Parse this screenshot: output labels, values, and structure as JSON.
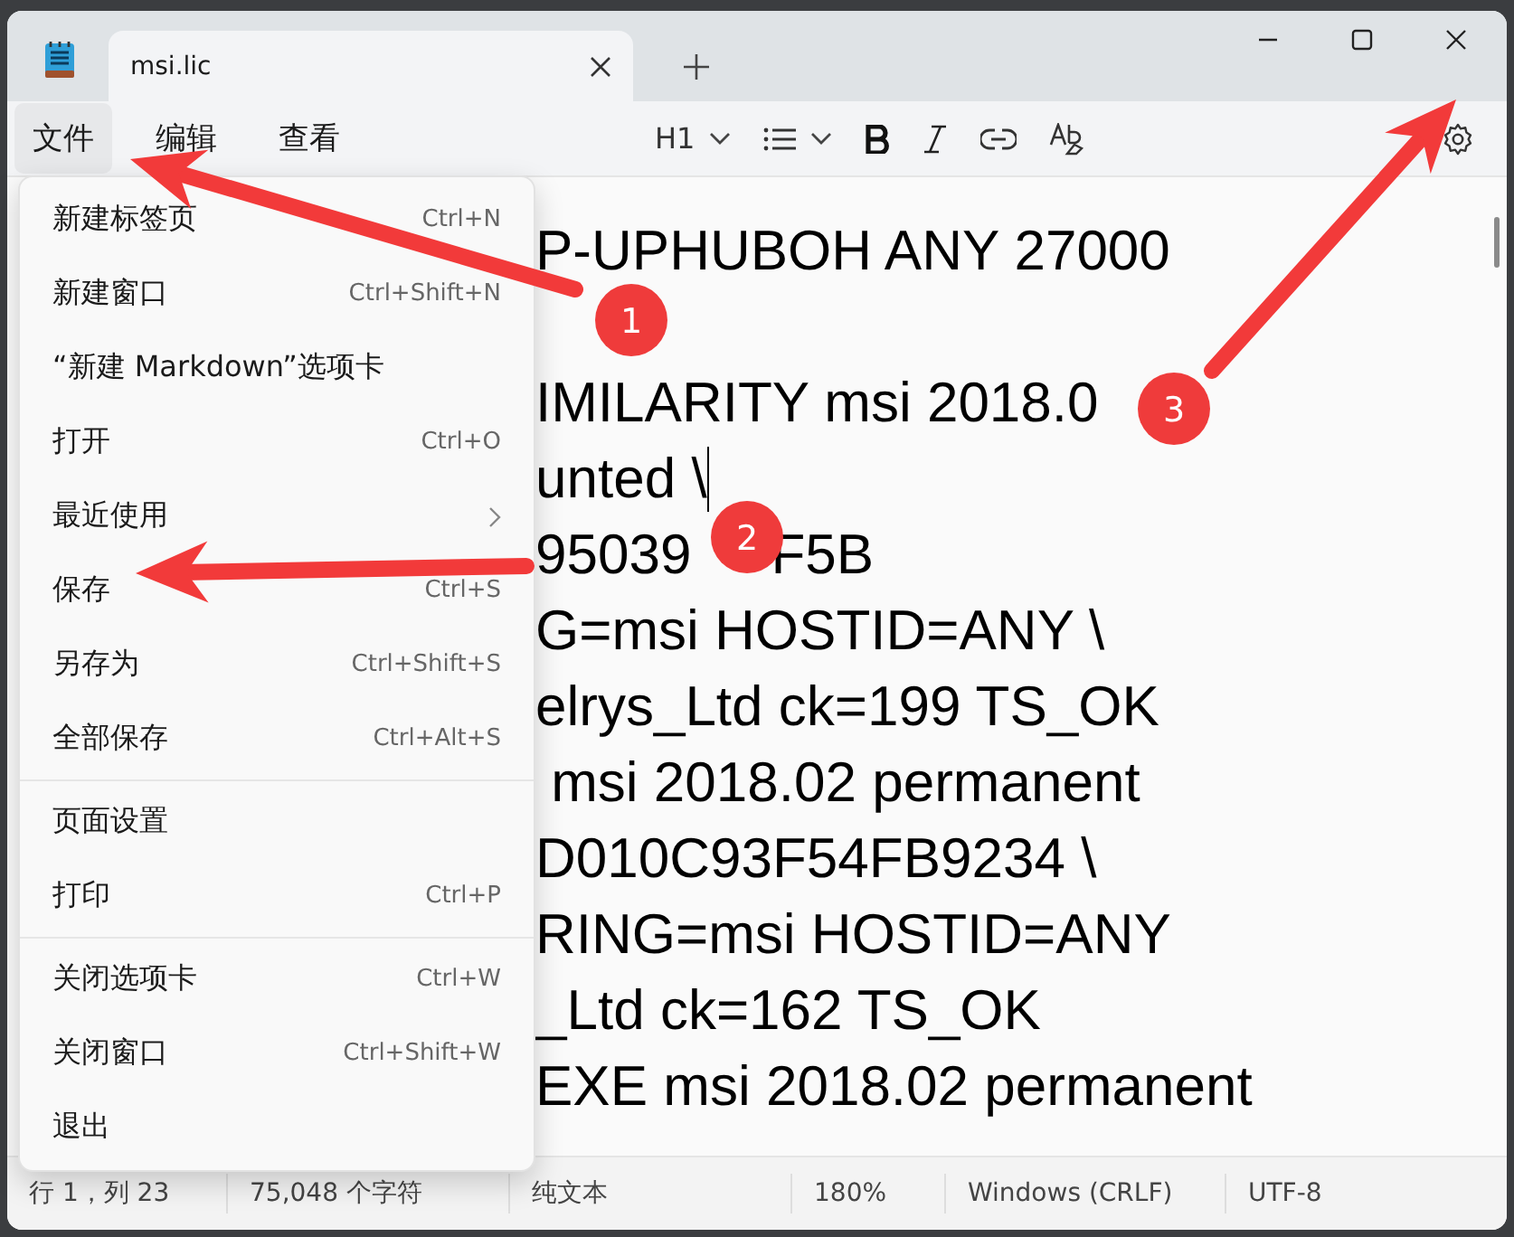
{
  "window": {
    "tab": {
      "title": "msi.lic",
      "selected": true
    }
  },
  "menu_bar": [
    {
      "label": "文件",
      "selected": true
    },
    {
      "label": "编辑",
      "selected": false
    },
    {
      "label": "查看",
      "selected": false
    }
  ],
  "format_toolbar": {
    "heading": "H1"
  },
  "editor": {
    "lines": [
      {
        "kind": "text",
        "parts": [
          "P-UPHUBOH ANY 27000"
        ],
        "cursor": false
      },
      {
        "kind": "blank"
      },
      {
        "kind": "text",
        "parts": [
          "IMILARITY msi 2018.0"
        ],
        "cursor": false
      },
      {
        "kind": "text",
        "parts": [
          "unted \\"
        ],
        "cursor": true
      },
      {
        "kind": "text",
        "parts": [
          "95039",
          "F5B"
        ],
        "cursor": false
      },
      {
        "kind": "text",
        "parts": [
          "G=msi HOSTID=ANY \\"
        ],
        "cursor": false
      },
      {
        "kind": "text",
        "parts": [
          "elrys_Ltd ck=199 TS_OK"
        ],
        "cursor": false
      },
      {
        "kind": "text",
        "parts": [
          " msi 2018.02 permanent"
        ],
        "cursor": false
      },
      {
        "kind": "text",
        "parts": [
          "D010C93F54FB9234 \\"
        ],
        "cursor": false
      },
      {
        "kind": "text",
        "parts": [
          "RING=msi HOSTID=ANY"
        ],
        "cursor": false
      },
      {
        "kind": "text",
        "parts": [
          "_Ltd ck=162 TS_OK"
        ],
        "cursor": false
      },
      {
        "kind": "text",
        "parts": [
          "EXE msi 2018.02 permanent"
        ],
        "cursor": false
      }
    ]
  },
  "file_menu": {
    "items": [
      {
        "kind": "item",
        "label": "新建标签页",
        "shortcut": "Ctrl+N"
      },
      {
        "kind": "item",
        "label": "新建窗口",
        "shortcut": "Ctrl+Shift+N"
      },
      {
        "kind": "item",
        "label": "“新建 Markdown”选项卡"
      },
      {
        "kind": "item",
        "label": "打开",
        "shortcut": "Ctrl+O"
      },
      {
        "kind": "submenu",
        "label": "最近使用"
      },
      {
        "kind": "item",
        "label": "保存",
        "shortcut": "Ctrl+S"
      },
      {
        "kind": "item",
        "label": "另存为",
        "shortcut": "Ctrl+Shift+S"
      },
      {
        "kind": "item",
        "label": "全部保存",
        "shortcut": "Ctrl+Alt+S"
      },
      {
        "kind": "separator"
      },
      {
        "kind": "item",
        "label": "页面设置"
      },
      {
        "kind": "item",
        "label": "打印",
        "shortcut": "Ctrl+P"
      },
      {
        "kind": "separator"
      },
      {
        "kind": "item",
        "label": "关闭选项卡",
        "shortcut": "Ctrl+W"
      },
      {
        "kind": "item",
        "label": "关闭窗口",
        "shortcut": "Ctrl+Shift+W"
      },
      {
        "kind": "item",
        "label": "退出"
      }
    ]
  },
  "status_bar": [
    "行 1，列 23",
    "75,048 个字符",
    "纯文本",
    "180%",
    "Windows (CRLF)",
    "UTF-8"
  ],
  "annotations": [
    {
      "number": "1"
    },
    {
      "number": "2"
    },
    {
      "number": "3"
    }
  ]
}
